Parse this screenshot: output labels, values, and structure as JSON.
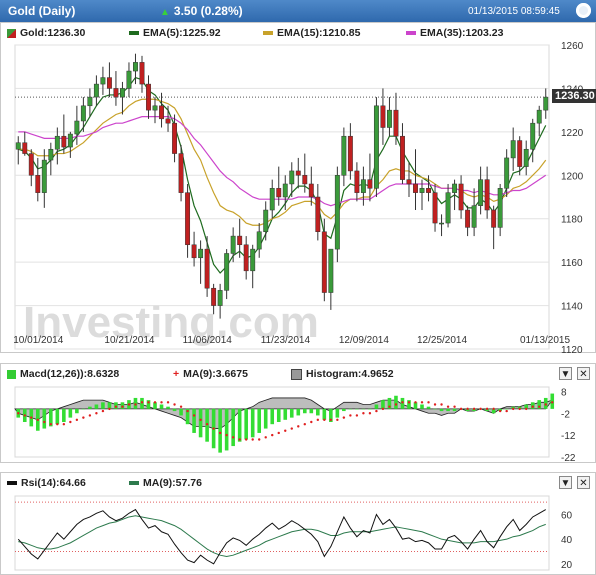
{
  "header": {
    "title": "Gold (Daily)",
    "change": "3.50 (0.28%)",
    "timestamp": "01/13/2015 08:59:45"
  },
  "price_panel": {
    "legend": [
      {
        "label": "Gold:1236.30",
        "color": "#3a9a3a"
      },
      {
        "label": "EMA(5):1225.92",
        "color": "#1e6b1e"
      },
      {
        "label": "EMA(15):1210.85",
        "color": "#c8a22a"
      },
      {
        "label": "EMA(35):1203.23",
        "color": "#cc44cc"
      }
    ],
    "last_price": "1236.30",
    "watermark": "Investing.com"
  },
  "macd_panel": {
    "legend": [
      {
        "label": "Macd(12,26)):8.6328",
        "color": "#33cc33"
      },
      {
        "label": "MA(9):3.6675",
        "color": "#e02020"
      },
      {
        "label": "Histogram:4.9652",
        "color": "#999999"
      }
    ]
  },
  "rsi_panel": {
    "legend": [
      {
        "label": "Rsi(14):64.66",
        "color": "#111111"
      },
      {
        "label": "MA(9):57.76",
        "color": "#2d7a4d"
      }
    ]
  },
  "x_labels": [
    "10/01/2014",
    "10/21/2014",
    "11/06/2014",
    "11/23/2014",
    "12/09/2014",
    "12/25/2014",
    "01/13/2015"
  ],
  "chart_data": [
    {
      "type": "candlestick",
      "title": "Gold (Daily)",
      "ylim": [
        1120,
        1260
      ],
      "yticks": [
        1120,
        1140,
        1160,
        1180,
        1200,
        1220,
        1240,
        1260
      ],
      "colors": {
        "up": "#3a9a3a",
        "down": "#c02020"
      },
      "ohlc": [
        [
          1212,
          1218,
          1205,
          1215
        ],
        [
          1215,
          1220,
          1209,
          1210
        ],
        [
          1210,
          1212,
          1195,
          1200
        ],
        [
          1200,
          1208,
          1188,
          1192
        ],
        [
          1192,
          1212,
          1185,
          1207
        ],
        [
          1207,
          1215,
          1200,
          1212
        ],
        [
          1212,
          1222,
          1205,
          1218
        ],
        [
          1218,
          1228,
          1210,
          1213
        ],
        [
          1213,
          1220,
          1208,
          1219
        ],
        [
          1219,
          1232,
          1214,
          1225
        ],
        [
          1225,
          1236,
          1220,
          1232
        ],
        [
          1232,
          1240,
          1227,
          1236
        ],
        [
          1236,
          1246,
          1232,
          1242
        ],
        [
          1242,
          1250,
          1237,
          1245
        ],
        [
          1245,
          1252,
          1236,
          1240
        ],
        [
          1240,
          1248,
          1232,
          1236
        ],
        [
          1236,
          1243,
          1228,
          1240
        ],
        [
          1240,
          1252,
          1236,
          1248
        ],
        [
          1248,
          1256,
          1242,
          1252
        ],
        [
          1252,
          1255,
          1238,
          1242
        ],
        [
          1242,
          1246,
          1226,
          1230
        ],
        [
          1230,
          1236,
          1224,
          1232
        ],
        [
          1232,
          1238,
          1222,
          1226
        ],
        [
          1226,
          1232,
          1220,
          1224
        ],
        [
          1224,
          1228,
          1206,
          1210
        ],
        [
          1210,
          1214,
          1188,
          1192
        ],
        [
          1192,
          1196,
          1162,
          1168
        ],
        [
          1168,
          1174,
          1158,
          1162
        ],
        [
          1162,
          1170,
          1150,
          1166
        ],
        [
          1166,
          1172,
          1144,
          1148
        ],
        [
          1148,
          1150,
          1136,
          1140
        ],
        [
          1140,
          1150,
          1134,
          1147
        ],
        [
          1147,
          1166,
          1143,
          1164
        ],
        [
          1164,
          1176,
          1160,
          1172
        ],
        [
          1172,
          1180,
          1162,
          1168
        ],
        [
          1168,
          1172,
          1152,
          1156
        ],
        [
          1156,
          1168,
          1148,
          1166
        ],
        [
          1166,
          1178,
          1162,
          1174
        ],
        [
          1174,
          1188,
          1170,
          1184
        ],
        [
          1184,
          1198,
          1180,
          1194
        ],
        [
          1194,
          1204,
          1186,
          1190
        ],
        [
          1190,
          1200,
          1184,
          1196
        ],
        [
          1196,
          1206,
          1190,
          1202
        ],
        [
          1202,
          1208,
          1194,
          1200
        ],
        [
          1200,
          1210,
          1192,
          1196
        ],
        [
          1196,
          1204,
          1186,
          1190
        ],
        [
          1190,
          1196,
          1170,
          1174
        ],
        [
          1174,
          1180,
          1142,
          1146
        ],
        [
          1146,
          1150,
          1138,
          1166
        ],
        [
          1166,
          1204,
          1160,
          1200
        ],
        [
          1200,
          1222,
          1195,
          1218
        ],
        [
          1218,
          1224,
          1198,
          1202
        ],
        [
          1202,
          1206,
          1188,
          1192
        ],
        [
          1192,
          1204,
          1186,
          1198
        ],
        [
          1198,
          1210,
          1188,
          1194
        ],
        [
          1194,
          1236,
          1190,
          1232
        ],
        [
          1232,
          1240,
          1214,
          1222
        ],
        [
          1222,
          1236,
          1218,
          1230
        ],
        [
          1230,
          1238,
          1214,
          1218
        ],
        [
          1218,
          1224,
          1196,
          1198
        ],
        [
          1198,
          1206,
          1190,
          1196
        ],
        [
          1196,
          1212,
          1184,
          1192
        ],
        [
          1192,
          1198,
          1184,
          1194
        ],
        [
          1194,
          1200,
          1188,
          1192
        ],
        [
          1192,
          1196,
          1174,
          1178
        ],
        [
          1178,
          1182,
          1172,
          1178
        ],
        [
          1178,
          1196,
          1176,
          1192
        ],
        [
          1192,
          1198,
          1184,
          1196
        ],
        [
          1196,
          1200,
          1180,
          1184
        ],
        [
          1184,
          1186,
          1172,
          1176
        ],
        [
          1176,
          1194,
          1172,
          1186
        ],
        [
          1186,
          1204,
          1182,
          1198
        ],
        [
          1198,
          1204,
          1180,
          1184
        ],
        [
          1184,
          1186,
          1166,
          1176
        ],
        [
          1176,
          1196,
          1172,
          1194
        ],
        [
          1194,
          1212,
          1190,
          1208
        ],
        [
          1208,
          1222,
          1202,
          1216
        ],
        [
          1216,
          1218,
          1200,
          1204
        ],
        [
          1204,
          1216,
          1200,
          1212
        ],
        [
          1212,
          1226,
          1206,
          1224
        ],
        [
          1224,
          1232,
          1218,
          1230
        ],
        [
          1230,
          1240,
          1226,
          1236
        ]
      ],
      "ema": [
        {
          "name": "EMA(5)",
          "color": "#1e6b1e",
          "values": [
            1212,
            1211,
            1208,
            1203,
            1204,
            1207,
            1211,
            1212,
            1214,
            1218,
            1222,
            1227,
            1232,
            1236,
            1237,
            1237,
            1238,
            1241,
            1245,
            1244,
            1239,
            1237,
            1233,
            1230,
            1223,
            1213,
            1198,
            1186,
            1179,
            1169,
            1159,
            1155,
            1158,
            1163,
            1165,
            1162,
            1163,
            1167,
            1173,
            1180,
            1183,
            1187,
            1192,
            1195,
            1195,
            1193,
            1187,
            1173,
            1171,
            1181,
            1193,
            1196,
            1195,
            1196,
            1195,
            1207,
            1212,
            1218,
            1218,
            1211,
            1206,
            1201,
            1199,
            1197,
            1191,
            1187,
            1189,
            1191,
            1189,
            1185,
            1185,
            1189,
            1187,
            1183,
            1187,
            1194,
            1201,
            1202,
            1205,
            1211,
            1217,
            1223
          ]
        },
        {
          "name": "EMA(15)",
          "color": "#c8a22a",
          "values": [
            1212,
            1212,
            1211,
            1209,
            1209,
            1209,
            1210,
            1210,
            1211,
            1213,
            1215,
            1218,
            1221,
            1224,
            1226,
            1228,
            1229,
            1232,
            1234,
            1235,
            1235,
            1235,
            1234,
            1233,
            1231,
            1226,
            1219,
            1212,
            1207,
            1199,
            1192,
            1186,
            1184,
            1183,
            1181,
            1178,
            1177,
            1177,
            1178,
            1180,
            1181,
            1183,
            1186,
            1187,
            1188,
            1188,
            1186,
            1182,
            1180,
            1183,
            1187,
            1189,
            1189,
            1190,
            1190,
            1195,
            1198,
            1202,
            1203,
            1202,
            1202,
            1200,
            1199,
            1198,
            1196,
            1194,
            1194,
            1194,
            1193,
            1191,
            1190,
            1191,
            1190,
            1188,
            1189,
            1191,
            1194,
            1195,
            1197,
            1200,
            1203,
            1207
          ]
        },
        {
          "name": "EMA(35)",
          "color": "#cc44cc",
          "values": [
            1220,
            1220,
            1219,
            1218,
            1217,
            1217,
            1217,
            1217,
            1217,
            1218,
            1218,
            1219,
            1220,
            1222,
            1223,
            1224,
            1224,
            1225,
            1226,
            1227,
            1227,
            1227,
            1227,
            1227,
            1226,
            1224,
            1221,
            1217,
            1214,
            1210,
            1206,
            1202,
            1199,
            1197,
            1194,
            1192,
            1190,
            1189,
            1189,
            1189,
            1189,
            1189,
            1189,
            1190,
            1190,
            1190,
            1189,
            1187,
            1186,
            1187,
            1188,
            1189,
            1189,
            1189,
            1189,
            1191,
            1193,
            1195,
            1196,
            1196,
            1196,
            1196,
            1196,
            1196,
            1195,
            1194,
            1194,
            1194,
            1193,
            1193,
            1192,
            1193,
            1192,
            1191,
            1191,
            1192,
            1193,
            1193,
            1194,
            1196,
            1198,
            1200
          ]
        }
      ]
    },
    {
      "type": "bar",
      "title": "MACD",
      "ylim": [
        -22,
        10
      ],
      "yticks": [
        8,
        -2,
        -12,
        -22
      ],
      "macd_bars": [
        -4,
        -6,
        -8,
        -10,
        -9,
        -8,
        -7,
        -6,
        -4,
        -2,
        0,
        1,
        2,
        3,
        3,
        3,
        3,
        4,
        5,
        5,
        4,
        3,
        2,
        1,
        -1,
        -3,
        -7,
        -11,
        -13,
        -15,
        -18,
        -20,
        -19,
        -17,
        -15,
        -14,
        -13,
        -11,
        -9,
        -7,
        -6,
        -5,
        -4,
        -3,
        -2,
        -2,
        -3,
        -5,
        -6,
        -4,
        -1,
        0,
        0,
        0,
        0,
        2,
        4,
        5,
        6,
        5,
        4,
        3,
        2,
        1,
        0,
        -1,
        -1,
        -1,
        0,
        -1,
        -1,
        0,
        -1,
        -2,
        -1,
        0,
        1,
        1,
        2,
        3,
        4,
        5,
        7
      ],
      "signal": [
        -2,
        -3,
        -4,
        -5,
        -6,
        -7,
        -7,
        -7,
        -6,
        -5,
        -4,
        -3,
        -2,
        -1,
        0,
        1,
        1,
        2,
        2,
        3,
        3,
        3,
        3,
        3,
        2,
        1,
        -1,
        -3,
        -5,
        -7,
        -9,
        -11,
        -12,
        -13,
        -14,
        -14,
        -14,
        -14,
        -13,
        -12,
        -11,
        -10,
        -9,
        -8,
        -7,
        -6,
        -5,
        -5,
        -5,
        -5,
        -4,
        -3,
        -3,
        -2,
        -2,
        -1,
        0,
        1,
        2,
        3,
        3,
        3,
        3,
        3,
        2,
        2,
        1,
        1,
        0,
        0,
        0,
        0,
        0,
        0,
        -1,
        -1,
        0,
        0,
        0,
        1,
        1,
        2,
        3
      ],
      "histogram": [
        -2,
        -3,
        -4,
        -5,
        -3,
        -1,
        0,
        1,
        2,
        3,
        4,
        4,
        4,
        4,
        3,
        2,
        2,
        2,
        3,
        2,
        1,
        0,
        -1,
        -2,
        -3,
        -4,
        -6,
        -8,
        -8,
        -8,
        -9,
        -9,
        -7,
        -4,
        -1,
        0,
        1,
        3,
        4,
        5,
        5,
        5,
        5,
        5,
        5,
        4,
        2,
        0,
        -1,
        1,
        3,
        3,
        3,
        2,
        2,
        3,
        4,
        4,
        4,
        2,
        1,
        0,
        -1,
        -2,
        -2,
        -3,
        -2,
        -2,
        0,
        -1,
        -1,
        0,
        -1,
        -2,
        0,
        1,
        1,
        1,
        2,
        2,
        3,
        3,
        4
      ]
    },
    {
      "type": "line",
      "title": "RSI",
      "ylim": [
        15,
        75
      ],
      "yticks": [
        60,
        40,
        20
      ],
      "reference_lines": [
        70,
        30
      ],
      "series": [
        {
          "name": "Rsi(14)",
          "color": "#111111",
          "values": [
            40,
            34,
            28,
            24,
            31,
            38,
            45,
            40,
            46,
            52,
            56,
            58,
            61,
            63,
            58,
            55,
            57,
            61,
            64,
            56,
            49,
            51,
            46,
            44,
            36,
            29,
            23,
            21,
            27,
            23,
            20,
            29,
            37,
            41,
            39,
            35,
            40,
            44,
            49,
            53,
            48,
            51,
            55,
            52,
            48,
            44,
            38,
            26,
            34,
            46,
            58,
            49,
            42,
            47,
            45,
            60,
            52,
            56,
            49,
            40,
            41,
            38,
            39,
            37,
            32,
            32,
            41,
            43,
            38,
            32,
            40,
            47,
            38,
            33,
            42,
            50,
            56,
            47,
            52,
            58,
            61,
            64
          ]
        },
        {
          "name": "MA(9)",
          "color": "#2d7a4d",
          "values": [
            38,
            37,
            35,
            33,
            32,
            32,
            33,
            35,
            37,
            40,
            43,
            46,
            49,
            51,
            53,
            54,
            56,
            58,
            59,
            58,
            57,
            56,
            55,
            53,
            51,
            48,
            44,
            40,
            36,
            32,
            29,
            27,
            26,
            27,
            29,
            31,
            33,
            35,
            38,
            40,
            42,
            44,
            46,
            47,
            48,
            48,
            47,
            45,
            43,
            43,
            45,
            46,
            46,
            46,
            46,
            47,
            48,
            49,
            50,
            49,
            48,
            47,
            46,
            44,
            42,
            40,
            39,
            38,
            37,
            37,
            37,
            38,
            38,
            38,
            39,
            40,
            42,
            43,
            45,
            47,
            50,
            52
          ]
        }
      ]
    }
  ]
}
